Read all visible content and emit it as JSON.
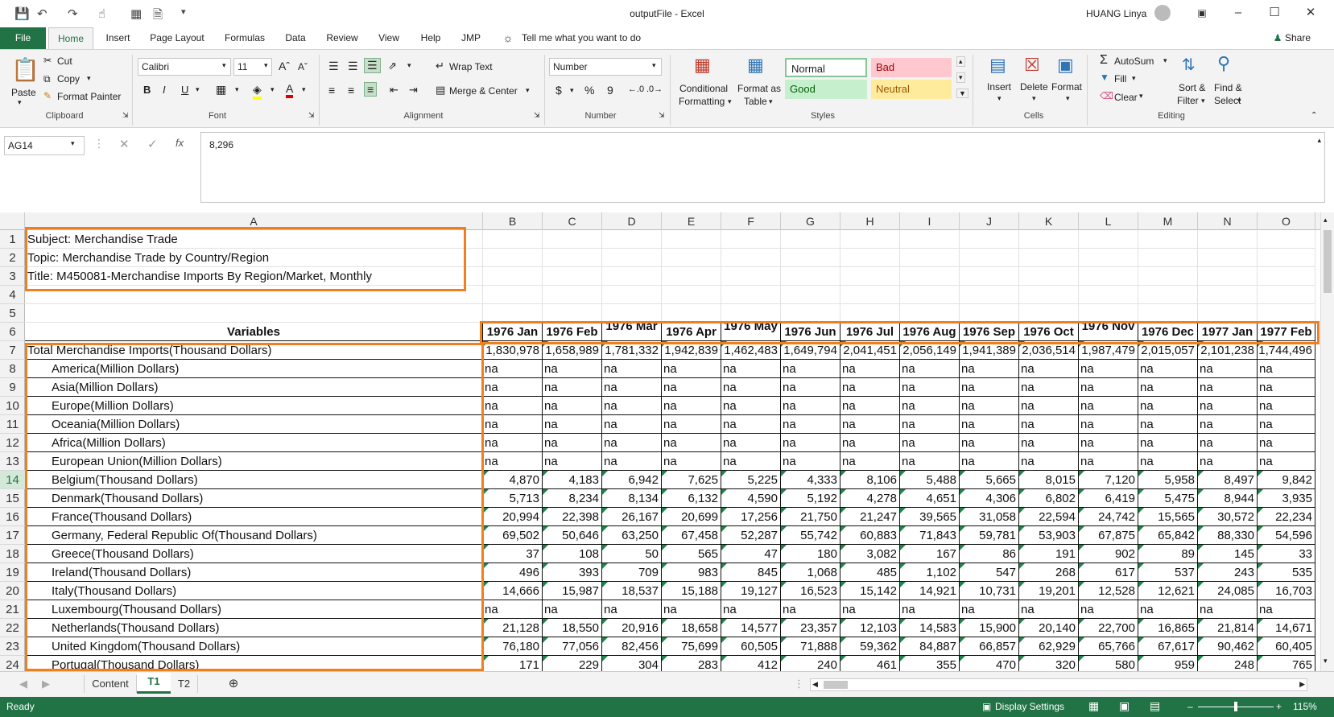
{
  "window": {
    "title": "outputFile  -  Excel",
    "user": "HUANG Linya"
  },
  "tabs": [
    "File",
    "Home",
    "Insert",
    "Page Layout",
    "Formulas",
    "Data",
    "Review",
    "View",
    "Help",
    "JMP"
  ],
  "tell_me": "Tell me what you want to do",
  "share": "Share",
  "ribbon": {
    "clipboard": {
      "paste": "Paste",
      "cut": "Cut",
      "copy": "Copy",
      "format_painter": "Format Painter",
      "label": "Clipboard"
    },
    "font": {
      "name": "Calibri",
      "size": "11",
      "label": "Font",
      "bold": "B",
      "italic": "I",
      "underline": "U"
    },
    "alignment": {
      "wrap": "Wrap Text",
      "merge": "Merge & Center",
      "label": "Alignment"
    },
    "number": {
      "format": "Number",
      "label": "Number",
      "currency": "$",
      "percent": "%",
      "comma": "9"
    },
    "styles": {
      "conditional": "Conditional",
      "conditional2": "Formatting",
      "format_table": "Format as",
      "format_table2": "Table",
      "normal": "Normal",
      "bad": "Bad",
      "good": "Good",
      "neutral": "Neutral",
      "label": "Styles"
    },
    "cells": {
      "insert": "Insert",
      "delete": "Delete",
      "format": "Format",
      "label": "Cells"
    },
    "editing": {
      "autosum": "AutoSum",
      "fill": "Fill",
      "clear": "Clear",
      "sort": "Sort &",
      "sort2": "Filter",
      "find": "Find &",
      "find2": "Select",
      "label": "Editing"
    }
  },
  "formula_bar": {
    "name_box": "AG14",
    "value": "8,296",
    "fx": "fx"
  },
  "columns": [
    "A",
    "B",
    "C",
    "D",
    "E",
    "F",
    "G",
    "H",
    "I",
    "J",
    "K",
    "L",
    "M",
    "N",
    "O"
  ],
  "rows": [
    "1",
    "2",
    "3",
    "4",
    "5",
    "6",
    "7",
    "8",
    "9",
    "10",
    "11",
    "12",
    "13",
    "14",
    "15",
    "16",
    "17",
    "18",
    "19",
    "20",
    "21",
    "22",
    "23",
    "24"
  ],
  "info": {
    "subject": "Subject: Merchandise Trade",
    "topic": "Topic: Merchandise Trade by Country/Region",
    "title": "Title: M450081-Merchandise Imports By Region/Market, Monthly"
  },
  "header_label": "Variables",
  "months": [
    "1976 Jan",
    "1976 Feb",
    "1976 Mar",
    "1976 Apr",
    "1976 May",
    "1976 Jun",
    "1976 Jul",
    "1976 Aug",
    "1976 Sep",
    "1976 Oct",
    "1976 Nov",
    "1976 Dec",
    "1977 Jan",
    "1977 Feb"
  ],
  "data": [
    {
      "name": "Total Merchandise Imports(Thousand Dollars)",
      "indent": false,
      "v": [
        "1,830,978",
        "1,658,989",
        "1,781,332",
        "1,942,839",
        "1,462,483",
        "1,649,794",
        "2,041,451",
        "2,056,149",
        "1,941,389",
        "2,036,514",
        "1,987,479",
        "2,015,057",
        "2,101,238",
        "1,744,496"
      ]
    },
    {
      "name": "America(Million Dollars)",
      "indent": true,
      "v": [
        "na",
        "na",
        "na",
        "na",
        "na",
        "na",
        "na",
        "na",
        "na",
        "na",
        "na",
        "na",
        "na",
        "na"
      ]
    },
    {
      "name": "Asia(Million Dollars)",
      "indent": true,
      "v": [
        "na",
        "na",
        "na",
        "na",
        "na",
        "na",
        "na",
        "na",
        "na",
        "na",
        "na",
        "na",
        "na",
        "na"
      ]
    },
    {
      "name": "Europe(Million Dollars)",
      "indent": true,
      "v": [
        "na",
        "na",
        "na",
        "na",
        "na",
        "na",
        "na",
        "na",
        "na",
        "na",
        "na",
        "na",
        "na",
        "na"
      ]
    },
    {
      "name": "Oceania(Million Dollars)",
      "indent": true,
      "v": [
        "na",
        "na",
        "na",
        "na",
        "na",
        "na",
        "na",
        "na",
        "na",
        "na",
        "na",
        "na",
        "na",
        "na"
      ]
    },
    {
      "name": "Africa(Million Dollars)",
      "indent": true,
      "v": [
        "na",
        "na",
        "na",
        "na",
        "na",
        "na",
        "na",
        "na",
        "na",
        "na",
        "na",
        "na",
        "na",
        "na"
      ]
    },
    {
      "name": "European Union(Million Dollars)",
      "indent": true,
      "v": [
        "na",
        "na",
        "na",
        "na",
        "na",
        "na",
        "na",
        "na",
        "na",
        "na",
        "na",
        "na",
        "na",
        "na"
      ]
    },
    {
      "name": "Belgium(Thousand Dollars)",
      "indent": true,
      "v": [
        "4,870",
        "4,183",
        "6,942",
        "7,625",
        "5,225",
        "4,333",
        "8,106",
        "5,488",
        "5,665",
        "8,015",
        "7,120",
        "5,958",
        "8,497",
        "9,842"
      ]
    },
    {
      "name": "Denmark(Thousand Dollars)",
      "indent": true,
      "v": [
        "5,713",
        "8,234",
        "8,134",
        "6,132",
        "4,590",
        "5,192",
        "4,278",
        "4,651",
        "4,306",
        "6,802",
        "6,419",
        "5,475",
        "8,944",
        "3,935"
      ]
    },
    {
      "name": "France(Thousand Dollars)",
      "indent": true,
      "v": [
        "20,994",
        "22,398",
        "26,167",
        "20,699",
        "17,256",
        "21,750",
        "21,247",
        "39,565",
        "31,058",
        "22,594",
        "24,742",
        "15,565",
        "30,572",
        "22,234"
      ]
    },
    {
      "name": "Germany, Federal Republic Of(Thousand Dollars)",
      "indent": true,
      "v": [
        "69,502",
        "50,646",
        "63,250",
        "67,458",
        "52,287",
        "55,742",
        "60,883",
        "71,843",
        "59,781",
        "53,903",
        "67,875",
        "65,842",
        "88,330",
        "54,596"
      ]
    },
    {
      "name": "Greece(Thousand Dollars)",
      "indent": true,
      "v": [
        "37",
        "108",
        "50",
        "565",
        "47",
        "180",
        "3,082",
        "167",
        "86",
        "191",
        "902",
        "89",
        "145",
        "33"
      ]
    },
    {
      "name": "Ireland(Thousand Dollars)",
      "indent": true,
      "v": [
        "496",
        "393",
        "709",
        "983",
        "845",
        "1,068",
        "485",
        "1,102",
        "547",
        "268",
        "617",
        "537",
        "243",
        "535"
      ]
    },
    {
      "name": "Italy(Thousand Dollars)",
      "indent": true,
      "v": [
        "14,666",
        "15,987",
        "18,537",
        "15,188",
        "19,127",
        "16,523",
        "15,142",
        "14,921",
        "10,731",
        "19,201",
        "12,528",
        "12,621",
        "24,085",
        "16,703"
      ]
    },
    {
      "name": "Luxembourg(Thousand Dollars)",
      "indent": true,
      "v": [
        "na",
        "na",
        "na",
        "na",
        "na",
        "na",
        "na",
        "na",
        "na",
        "na",
        "na",
        "na",
        "na",
        "na"
      ]
    },
    {
      "name": "Netherlands(Thousand Dollars)",
      "indent": true,
      "v": [
        "21,128",
        "18,550",
        "20,916",
        "18,658",
        "14,577",
        "23,357",
        "12,103",
        "14,583",
        "15,900",
        "20,140",
        "22,700",
        "16,865",
        "21,814",
        "14,671"
      ]
    },
    {
      "name": "United Kingdom(Thousand Dollars)",
      "indent": true,
      "v": [
        "76,180",
        "77,056",
        "82,456",
        "75,699",
        "60,505",
        "71,888",
        "59,362",
        "84,887",
        "66,857",
        "62,929",
        "65,766",
        "67,617",
        "90,462",
        "60,405"
      ]
    },
    {
      "name": "Portugal(Thousand Dollars)",
      "indent": true,
      "v": [
        "171",
        "229",
        "304",
        "283",
        "412",
        "240",
        "461",
        "355",
        "470",
        "320",
        "580",
        "959",
        "248",
        "765"
      ]
    }
  ],
  "sheets": [
    "Content",
    "T1",
    "T2"
  ],
  "status": {
    "ready": "Ready",
    "display": "Display Settings",
    "zoom": "115%"
  }
}
